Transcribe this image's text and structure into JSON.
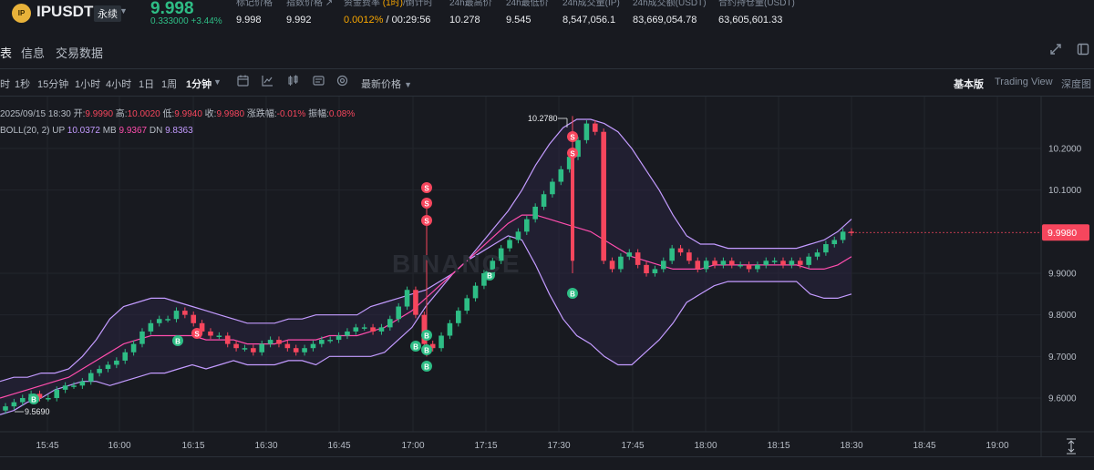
{
  "header": {
    "logo_text": "IP",
    "symbol": "IPUSDT",
    "contract_type": "永续",
    "last_price": "9.998",
    "change_abs": "0.333000",
    "change_pct": "+3.44%",
    "stats": [
      {
        "label": "标记价格",
        "value": "9.998"
      },
      {
        "label": "指数价格 ↗",
        "value": "9.992"
      },
      {
        "label_prefix": "资金费率 ",
        "label_em": "(1时)",
        "label_suffix": "/倒计时",
        "value_rate": "0.0012%",
        "value_sep": " / ",
        "value_countdown": "00:29:56"
      },
      {
        "label": "24h最高价",
        "value": "10.278"
      },
      {
        "label": "24h最低价",
        "value": "9.545"
      },
      {
        "label": "24h成交量(IP)",
        "value": "8,547,056.1"
      },
      {
        "label": "24h成交额(USDT)",
        "value": "83,669,054.78"
      },
      {
        "label": "合约持仓量(USDT)",
        "value": "63,605,601.33"
      }
    ]
  },
  "tabs": {
    "items": [
      "表",
      "信息",
      "交易数据"
    ]
  },
  "toolbar": {
    "timeframes": [
      "时",
      "1秒",
      "15分钟",
      "1小时",
      "4小时",
      "1日",
      "1周",
      "1分钟"
    ],
    "active_timeframe": "1分钟",
    "price_type": "最新价格",
    "views": [
      "基本版",
      "Trading View",
      "深度图"
    ],
    "active_view": "基本版"
  },
  "legend": {
    "datetime": "2025/09/15 18:30",
    "open_label": "开:",
    "open": "9.9990",
    "high_label": "高:",
    "high": "10.0020",
    "low_label": "低:",
    "low": "9.9940",
    "close_label": "收:",
    "close": "9.9980",
    "chg_label": "涨跌幅:",
    "chg": "-0.01%",
    "amp_label": "振幅:",
    "amp": "0.08%",
    "boll_label": "BOLL(20, 2)",
    "up_label": "UP",
    "up": "10.0372",
    "mb_label": "MB",
    "mb": "9.9367",
    "dn_label": "DN",
    "dn": "9.8363"
  },
  "watermark": "BINANCE",
  "chart_data": {
    "type": "line",
    "y_ticks": [
      "10.2000",
      "10.1000",
      "9.9980",
      "9.9000",
      "9.8000",
      "9.7000",
      "9.6000"
    ],
    "y_tick_values": [
      10.2,
      10.1,
      9.998,
      9.9,
      9.8,
      9.7,
      9.6
    ],
    "x_ticks": [
      "15:45",
      "16:00",
      "16:15",
      "16:30",
      "16:45",
      "17:00",
      "17:15",
      "17:30",
      "17:45",
      "18:00",
      "18:15",
      "18:30",
      "18:45",
      "19:00"
    ],
    "current_price": "9.9980",
    "max_label": "10.2780",
    "min_label": "9.5690",
    "ylim": [
      9.54,
      10.3
    ],
    "colors": {
      "up": "#2ebd85",
      "down": "#f6465d",
      "boll_band": "#c39bff",
      "boll_mid": "#ff4dad"
    },
    "close": [
      9.58,
      9.59,
      9.6,
      9.61,
      9.6,
      9.6,
      9.62,
      9.63,
      9.63,
      9.64,
      9.66,
      9.67,
      9.68,
      9.69,
      9.71,
      9.73,
      9.76,
      9.78,
      9.79,
      9.79,
      9.81,
      9.8,
      9.78,
      9.76,
      9.75,
      9.75,
      9.73,
      9.72,
      9.72,
      9.71,
      9.73,
      9.74,
      9.73,
      9.72,
      9.71,
      9.72,
      9.73,
      9.74,
      9.74,
      9.75,
      9.76,
      9.77,
      9.77,
      9.76,
      9.77,
      9.79,
      9.82,
      9.86,
      9.8,
      9.73,
      9.72,
      9.75,
      9.78,
      9.81,
      9.84,
      9.87,
      9.9,
      9.93,
      9.96,
      9.98,
      10.0,
      10.03,
      10.06,
      10.09,
      10.12,
      10.15,
      10.18,
      10.22,
      10.26,
      10.24,
      9.93,
      9.91,
      9.94,
      9.95,
      9.92,
      9.9,
      9.91,
      9.93,
      9.96,
      9.95,
      9.93,
      9.91,
      9.93,
      9.92,
      9.93,
      9.92,
      9.92,
      9.91,
      9.92,
      9.93,
      9.93,
      9.92,
      9.93,
      9.92,
      9.94,
      9.95,
      9.97,
      9.98,
      10.0,
      9.998
    ],
    "boll_up": [
      9.64,
      9.65,
      9.65,
      9.66,
      9.66,
      9.67,
      9.7,
      9.74,
      9.79,
      9.82,
      9.83,
      9.84,
      9.84,
      9.83,
      9.82,
      9.81,
      9.8,
      9.79,
      9.78,
      9.78,
      9.78,
      9.79,
      9.79,
      9.8,
      9.8,
      9.8,
      9.8,
      9.82,
      9.83,
      9.84,
      9.85,
      9.86,
      9.88,
      9.9,
      9.93,
      9.97,
      10.01,
      10.05,
      10.1,
      10.16,
      10.21,
      10.25,
      10.27,
      10.27,
      10.26,
      10.24,
      10.2,
      10.15,
      10.1,
      10.04,
      9.99,
      9.97,
      9.97,
      9.96,
      9.96,
      9.96,
      9.96,
      9.96,
      9.96,
      9.97,
      9.98,
      10.0,
      10.03
    ],
    "boll_mid": [
      9.6,
      9.61,
      9.62,
      9.63,
      9.64,
      9.65,
      9.67,
      9.69,
      9.71,
      9.73,
      9.74,
      9.75,
      9.75,
      9.75,
      9.75,
      9.74,
      9.74,
      9.74,
      9.73,
      9.73,
      9.73,
      9.74,
      9.74,
      9.74,
      9.75,
      9.75,
      9.75,
      9.76,
      9.77,
      9.79,
      9.81,
      9.84,
      9.87,
      9.9,
      9.93,
      9.96,
      9.99,
      10.02,
      10.04,
      10.04,
      10.03,
      10.02,
      10.01,
      10.0,
      9.98,
      9.96,
      9.94,
      9.93,
      9.92,
      9.91,
      9.91,
      9.91,
      9.92,
      9.92,
      9.92,
      9.92,
      9.92,
      9.92,
      9.92,
      9.91,
      9.91,
      9.92,
      9.94
    ],
    "boll_dn": [
      9.56,
      9.57,
      9.59,
      9.6,
      9.62,
      9.63,
      9.64,
      9.64,
      9.63,
      9.64,
      9.65,
      9.66,
      9.66,
      9.67,
      9.68,
      9.67,
      9.68,
      9.69,
      9.68,
      9.68,
      9.68,
      9.69,
      9.69,
      9.68,
      9.7,
      9.7,
      9.7,
      9.7,
      9.71,
      9.74,
      9.77,
      9.82,
      9.86,
      9.9,
      9.93,
      9.95,
      9.97,
      9.99,
      9.98,
      9.92,
      9.85,
      9.79,
      9.75,
      9.73,
      9.7,
      9.68,
      9.68,
      9.71,
      9.74,
      9.78,
      9.83,
      9.85,
      9.87,
      9.88,
      9.88,
      9.88,
      9.88,
      9.88,
      9.88,
      9.85,
      9.84,
      9.84,
      9.85
    ],
    "buy_markers": 7,
    "sell_markers": 6
  }
}
